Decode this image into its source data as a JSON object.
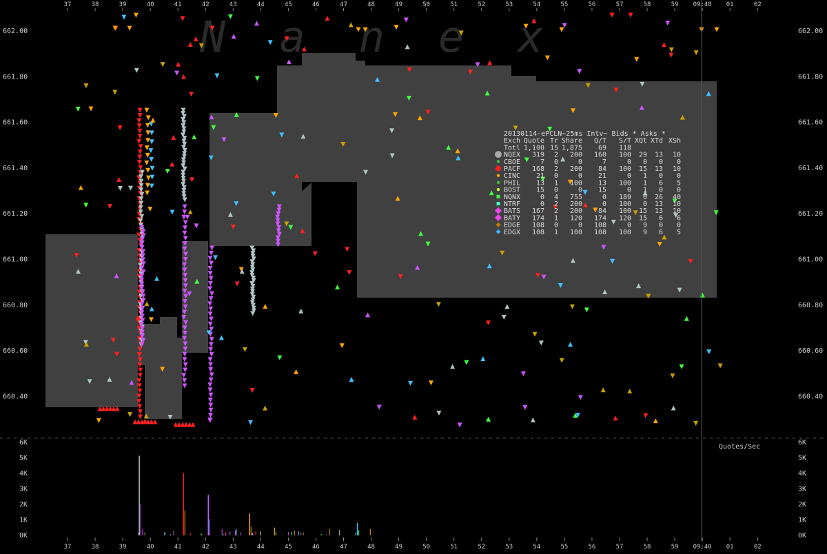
{
  "watermark": "Nanex",
  "chart_data": [
    {
      "type": "scatter",
      "x_ticks": [
        "37",
        "38",
        "39",
        "40",
        "41",
        "42",
        "43",
        "44",
        "45",
        "46",
        "47",
        "48",
        "49",
        "50",
        "51",
        "52",
        "53",
        "54",
        "55",
        "56",
        "57",
        "58",
        "59",
        "09:40",
        "01",
        "02"
      ],
      "y_ticks": [
        "662.00",
        "661.80",
        "661.60",
        "661.40",
        "661.20",
        "661.00",
        "660.80",
        "660.60",
        "660.40"
      ],
      "ylim": [
        660.2,
        662.1
      ],
      "grid": false,
      "shaded_region_color": "#404040",
      "series": [
        {
          "name": "NQEX",
          "color": "#b0c4c4"
        },
        {
          "name": "PACF",
          "color": "#ff2020"
        },
        {
          "name": "BATS",
          "color": "#cc55ff"
        },
        {
          "name": "EDGE",
          "color": "#ffa500"
        },
        {
          "name": "EDGX",
          "color": "#40c0ff"
        },
        {
          "name": "CINC",
          "color": "#c8a000"
        },
        {
          "name": "NQNX",
          "color": "#40ff40"
        }
      ]
    },
    {
      "type": "bar",
      "title": "Quotes/Sec",
      "y_ticks": [
        "6K",
        "5K",
        "4K",
        "3K",
        "2K",
        "1K",
        "0K"
      ],
      "ylim": [
        0,
        6000
      ],
      "spikes": [
        {
          "x": "39.6",
          "value": 5100
        },
        {
          "x": "41.2",
          "value": 4000
        },
        {
          "x": "42.1",
          "value": 2600
        },
        {
          "x": "43.6",
          "value": 1400
        },
        {
          "x": "47.5",
          "value": 800
        },
        {
          "x": "44.5",
          "value": 500
        }
      ]
    }
  ],
  "stats_table": {
    "title": "20130114-ePCLN~25ms Intv~ Bids * Asks *",
    "headers": [
      "Exch",
      "Quote",
      "Tr",
      "Share",
      "Q/T",
      "S/T",
      "XQt",
      "XTd",
      "XSh"
    ],
    "rows": [
      {
        "exch": "Totl",
        "quote": "1,100",
        "tr": "15",
        "share": "1,875",
        "qt": "69",
        "st": "118",
        "xqt": "",
        "xtd": "",
        "xsh": "",
        "color": "",
        "marker": ""
      },
      {
        "exch": "NQEX",
        "quote": "319",
        "tr": "2",
        "share": "200",
        "qt": "160",
        "st": "100",
        "xqt": "29",
        "xtd": "13",
        "xsh": "10",
        "color": "#a9a9a9",
        "marker": "octagon"
      },
      {
        "exch": "CBOE",
        "quote": "7",
        "tr": "0",
        "share": "0",
        "qt": "7",
        "st": "0",
        "xqt": "0",
        "xtd": "0",
        "xsh": "0",
        "color": "#40c040",
        "marker": "dot"
      },
      {
        "exch": "PACF",
        "quote": "168",
        "tr": "2",
        "share": "200",
        "qt": "84",
        "st": "100",
        "xqt": "15",
        "xtd": "13",
        "xsh": "10",
        "color": "#ff2020",
        "marker": "circle"
      },
      {
        "exch": "CINC",
        "quote": "21",
        "tr": "0",
        "share": "0",
        "qt": "21",
        "st": "0",
        "xqt": "1",
        "xtd": "0",
        "xsh": "0",
        "color": "#ffa500",
        "marker": "dot"
      },
      {
        "exch": "PHIL",
        "quote": "13",
        "tr": "1",
        "share": "100",
        "qt": "13",
        "st": "100",
        "xqt": "1",
        "xtd": "6",
        "xsh": "5",
        "color": "#40c040",
        "marker": "dot"
      },
      {
        "exch": "BOST",
        "quote": "15",
        "tr": "0",
        "share": "0",
        "qt": "15",
        "st": "0",
        "xqt": "1",
        "xtd": "0",
        "xsh": "0",
        "color": "#c0ff40",
        "marker": "dot"
      },
      {
        "exch": "NQNX",
        "quote": "0",
        "tr": "4",
        "share": "755",
        "qt": "0",
        "st": "189",
        "xqt": "0",
        "xtd": "26",
        "xsh": "40",
        "color": "#40ff40",
        "marker": "square"
      },
      {
        "exch": "NTRF",
        "quote": "0",
        "tr": "2",
        "share": "200",
        "qt": "0",
        "st": "100",
        "xqt": "0",
        "xtd": "13",
        "xsh": "10",
        "color": "#40ffc0",
        "marker": "square"
      },
      {
        "exch": "BATS",
        "quote": "167",
        "tr": "2",
        "share": "200",
        "qt": "84",
        "st": "100",
        "xqt": "15",
        "xtd": "13",
        "xsh": "10",
        "color": "#ee44ee",
        "marker": "diamond"
      },
      {
        "exch": "BATY",
        "quote": "174",
        "tr": "1",
        "share": "120",
        "qt": "174",
        "st": "120",
        "xqt": "15",
        "xtd": "6",
        "xsh": "6",
        "color": "#ee44ee",
        "marker": "diamond"
      },
      {
        "exch": "EDGE",
        "quote": "108",
        "tr": "0",
        "share": "0",
        "qt": "108",
        "st": "0",
        "xqt": "9",
        "xtd": "0",
        "xsh": "0",
        "color": "#c08000",
        "marker": "diamond-s"
      },
      {
        "exch": "EDGX",
        "quote": "108",
        "tr": "1",
        "share": "100",
        "qt": "108",
        "st": "100",
        "xqt": "9",
        "xtd": "6",
        "xsh": "5",
        "color": "#40b0ff",
        "marker": "diamond-s"
      }
    ]
  }
}
